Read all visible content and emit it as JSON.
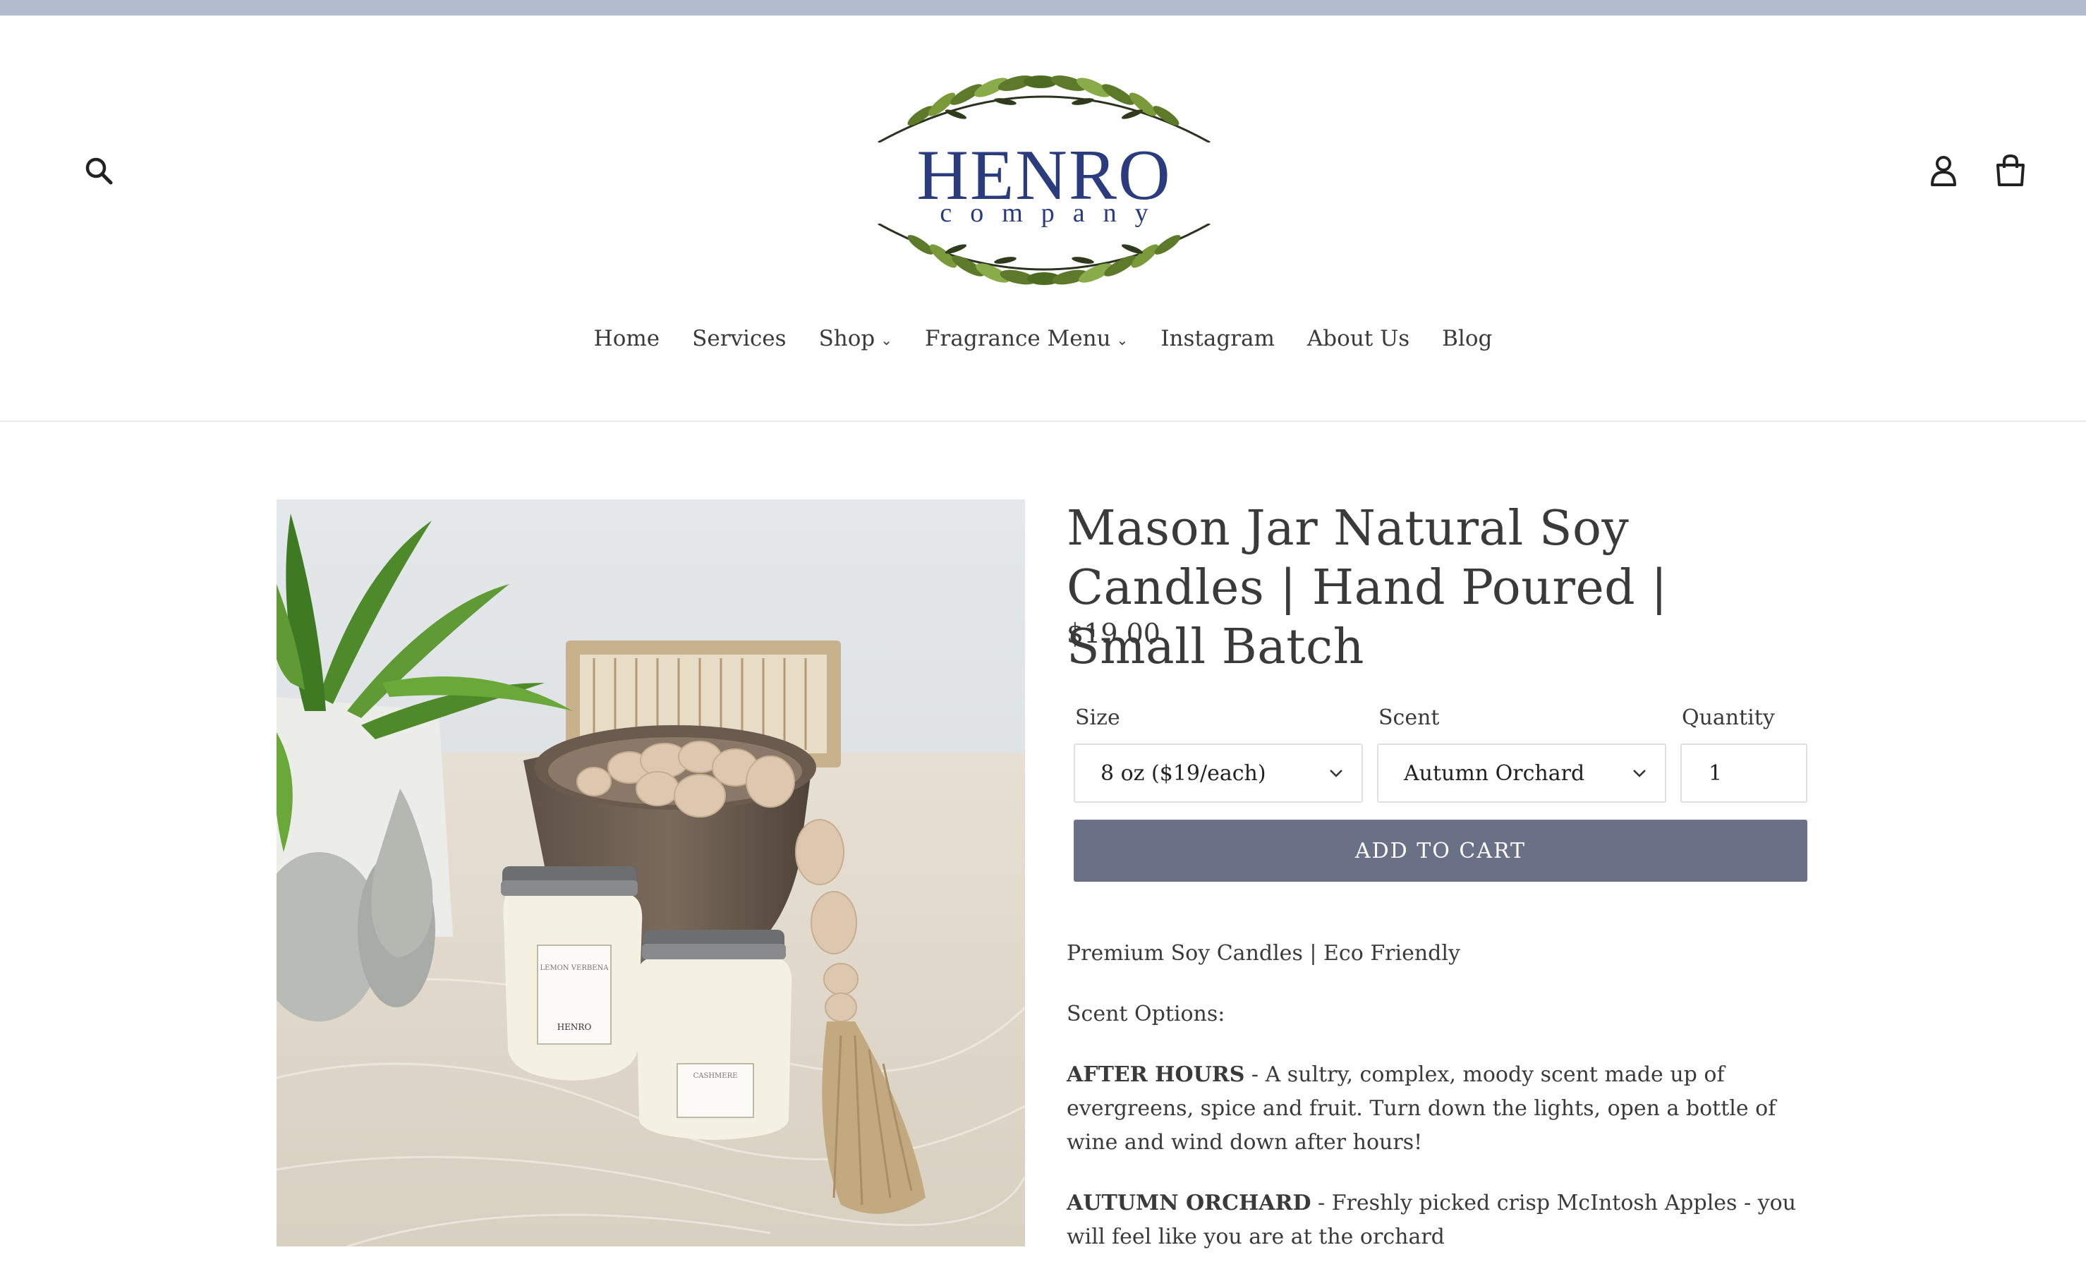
{
  "store": {
    "logo_main": "HENRO",
    "logo_sub": "company"
  },
  "header_icons": [
    "search-icon",
    "account-icon",
    "cart-icon"
  ],
  "nav": {
    "home": "Home",
    "services": "Services",
    "shop": "Shop",
    "fragrance_menu": "Fragrance Menu",
    "instagram": "Instagram",
    "about_us": "About Us",
    "blog": "Blog"
  },
  "product": {
    "title": "Mason Jar Natural Soy Candles | Hand Poured | Small Batch",
    "price": "$19.00",
    "size_label": "Size",
    "size_value": "8 oz ($19/each)",
    "scent_label": "Scent",
    "scent_value": "Autumn Orchard",
    "quantity_label": "Quantity",
    "quantity_value": "1",
    "add_to_cart": "ADD TO CART",
    "image_labels": {
      "jar1_line1": "LEMON VERBENA",
      "jar1_brand": "HENRO",
      "jar2_line1": "CASHMERE"
    }
  },
  "description": {
    "line1": "Premium Soy Candles | Eco Friendly",
    "line2": "Scent Options:",
    "after_hours_name": "AFTER HOURS",
    "after_hours_text": " - A sultry, complex, moody scent made up of evergreens, spice and fruit. Turn down the lights, open a bottle of wine and wind down after hours!",
    "autumn_orchard_name": "AUTUMN ORCHARD",
    "autumn_orchard_text": " - Freshly picked crisp McIntosh Apples - you will feel like you are at the orchard"
  },
  "colors": {
    "top_bar": "#b3bbcf",
    "logo_blue": "#2a3b7e",
    "button": "#6a7187",
    "text": "#3a3a3a"
  }
}
